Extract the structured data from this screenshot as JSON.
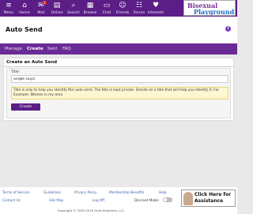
{
  "nav": {
    "items": [
      {
        "label": "Menu",
        "icon": "menu-icon",
        "glyph": "≡"
      },
      {
        "label": "Home",
        "icon": "home-icon",
        "glyph": "⌂"
      },
      {
        "label": "Mail",
        "icon": "mail-icon",
        "glyph": "✉",
        "badge": "1"
      },
      {
        "label": "Online",
        "icon": "online-icon",
        "glyph": "▤"
      },
      {
        "label": "Search",
        "icon": "search-icon",
        "glyph": "⌕"
      },
      {
        "label": "Browse",
        "icon": "browse-icon",
        "glyph": "▦"
      },
      {
        "label": "Chat",
        "icon": "chat-icon",
        "glyph": "▭"
      },
      {
        "label": "Friends",
        "icon": "friends-icon",
        "glyph": "☺"
      },
      {
        "label": "Forum",
        "icon": "forum-icon",
        "glyph": "☷"
      },
      {
        "label": "Interests",
        "icon": "interests-icon",
        "glyph": "♥"
      }
    ],
    "logo": {
      "line1": "Bisexual",
      "line2": "Playground"
    }
  },
  "page": {
    "title": "Auto Send",
    "info_glyph": "i"
  },
  "tabs": [
    {
      "label": "Manage",
      "active": false
    },
    {
      "label": "Create",
      "active": true
    },
    {
      "label": "Sent",
      "active": false
    },
    {
      "label": "FAQ",
      "active": false
    }
  ],
  "form": {
    "heading": "Create an Auto Send",
    "title_label": "Title:",
    "title_value": "Single Guys",
    "notice": "Title is only to help you identify this auto send. The title is kept private. Decide on a title that will help you identify it. For Example: Women in my area",
    "create_label": "Create"
  },
  "footer": {
    "links_row1": [
      "Terms of Service",
      "Guidelines",
      "Privacy Policy",
      "Membership Benefits",
      "Help"
    ],
    "links_row2": [
      "Contact Us",
      "Site Map",
      "Log Off"
    ],
    "discreet_label": "Discreet Mode:",
    "copyright": "Copyright © 2002-2018 Gold Dreamers, LLC",
    "assist_line1": "Click Here for",
    "assist_line2": "Assistance"
  },
  "colors": {
    "brand": "#5b1d86",
    "tabbar": "#6a2b96",
    "notice": "#fdf6d0"
  }
}
